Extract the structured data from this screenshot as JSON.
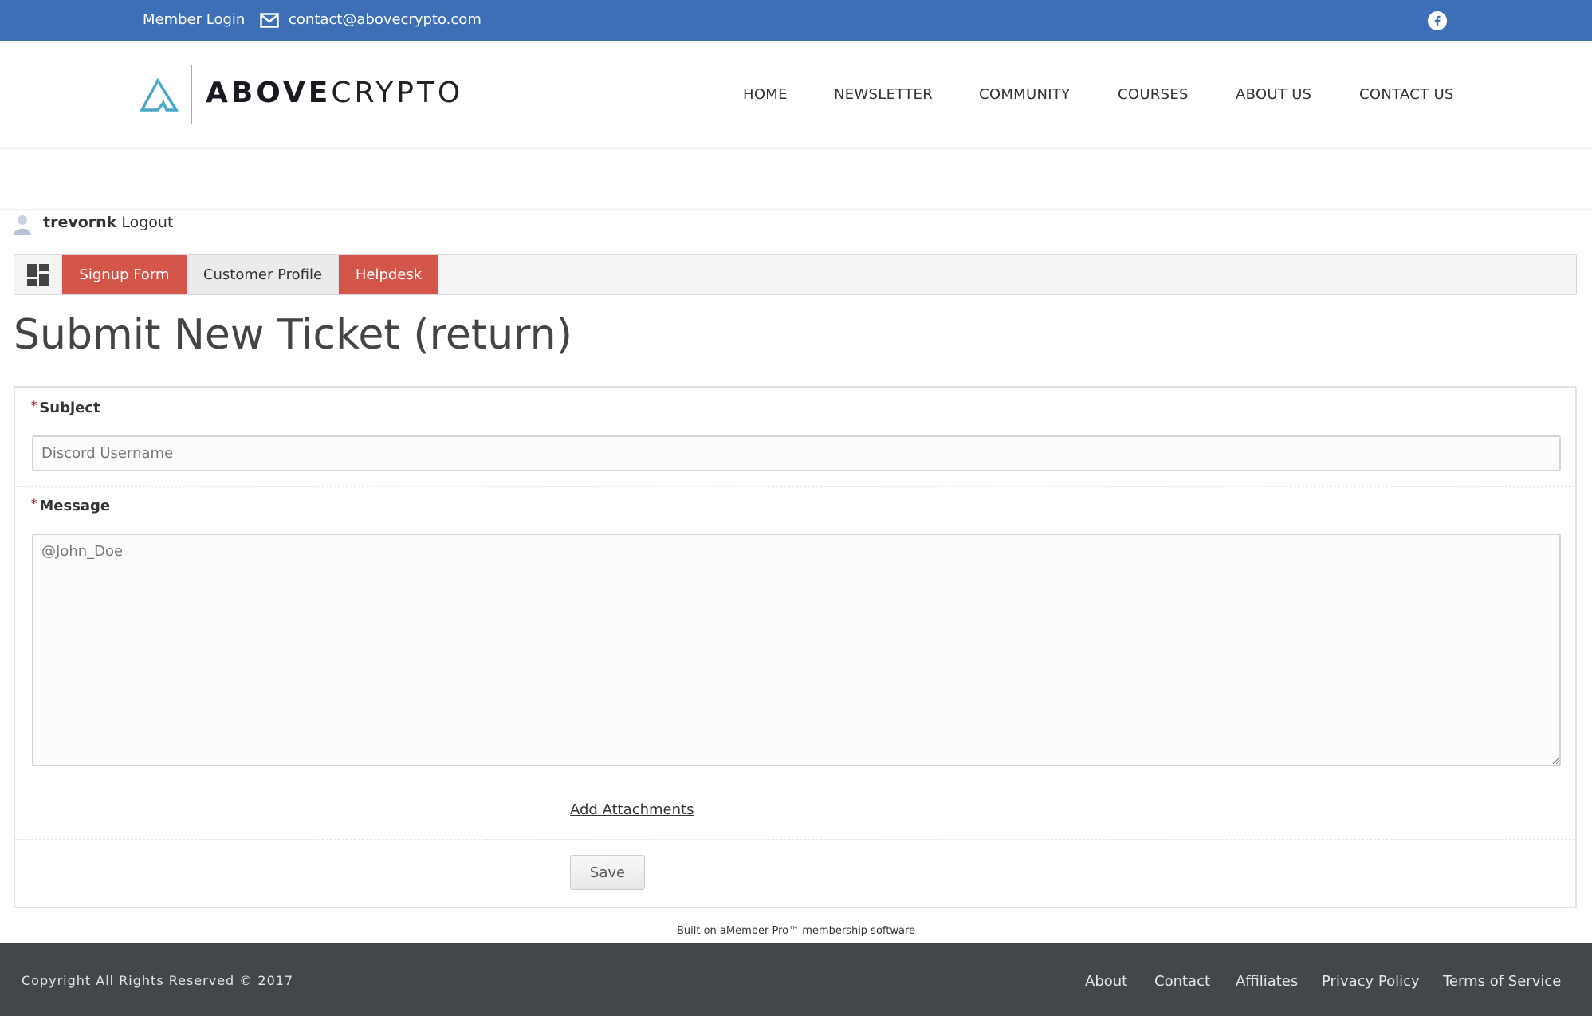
{
  "topbar": {
    "member_login": "Member Login",
    "email": "contact@abovecrypto.com",
    "social_icon": "facebook-icon",
    "color": "#3d6fb6"
  },
  "header": {
    "logo_bold": "ABOVE",
    "logo_light": "CRYPTO",
    "nav": [
      "HOME",
      "NEWSLETTER",
      "COMMUNITY",
      "COURSES",
      "ABOUT US",
      "CONTACT US"
    ]
  },
  "user": {
    "username": "trevornk",
    "logout": "Logout"
  },
  "tabs": [
    {
      "label": "Signup Form"
    },
    {
      "label": "Customer Profile"
    },
    {
      "label": "Helpdesk"
    }
  ],
  "accent": "#d4564a",
  "page_title": "Submit New Ticket (return)",
  "form": {
    "subject_label": "Subject",
    "subject_placeholder": "Discord Username",
    "message_label": "Message",
    "message_placeholder": "@John_Doe",
    "required_mark": "*",
    "add_attachments": "Add Attachments",
    "save": "Save"
  },
  "powered_by": {
    "prefix": "Built on ",
    "product": "aMember Pro™",
    "suffix": " membership software"
  },
  "footer": {
    "copyright": "Copyright All Rights Reserved © 2017",
    "links": [
      "About",
      "Contact",
      "Affiliates",
      "Privacy Policy",
      "Terms of Service"
    ]
  }
}
